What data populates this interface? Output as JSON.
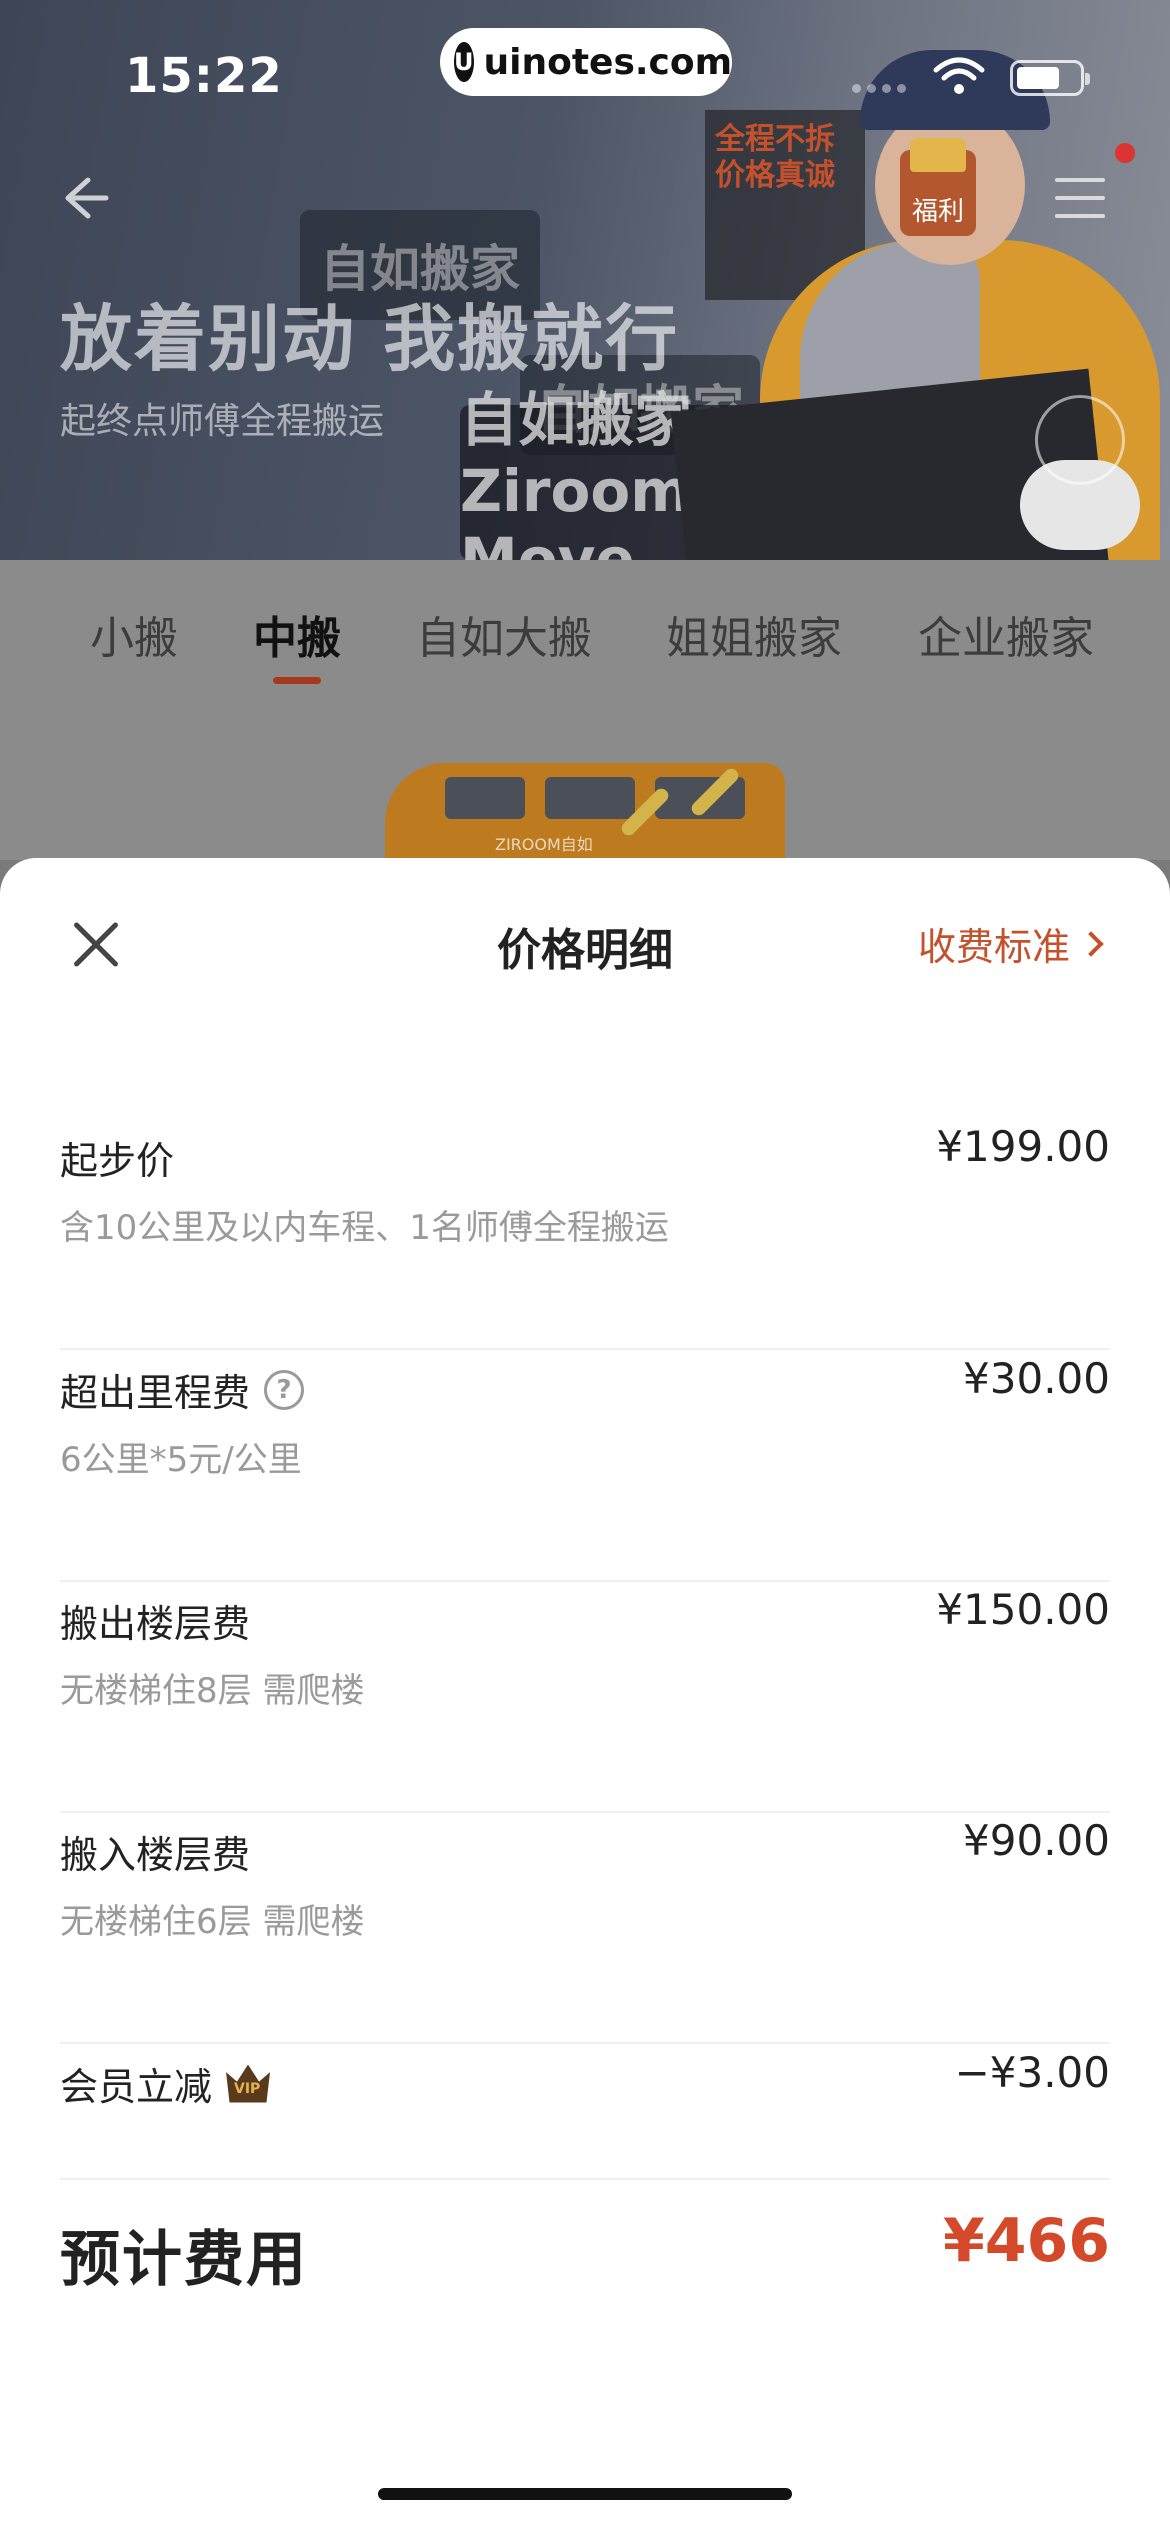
{
  "status_bar": {
    "time": "15:22",
    "watermark_logo": "U",
    "watermark": "uinotes.com"
  },
  "hero": {
    "title": "放着别动 我搬就行",
    "subtitle": "起终点师傅全程搬运",
    "board_texts": [
      "自如搬家",
      "自如搬家",
      "自如搬家 Ziroom Move"
    ],
    "sign_text": "全程不拆 价格真诚",
    "welfare_badge": "福利"
  },
  "tabs": [
    {
      "label": "小搬",
      "active": false
    },
    {
      "label": "中搬",
      "active": true
    },
    {
      "label": "自如大搬",
      "active": false
    },
    {
      "label": "姐姐搬家",
      "active": false
    },
    {
      "label": "企业搬家",
      "active": false
    }
  ],
  "vehicle": {
    "logo_text": "ZIROOM自如"
  },
  "sheet": {
    "title": "价格明细",
    "fee_standard_link": "收费标准",
    "items": [
      {
        "label": "起步价",
        "desc": "含10公里及以内车程、1名师傅全程搬运",
        "amount": "¥199.00"
      },
      {
        "label": "超出里程费",
        "desc": "6公里*5元/公里",
        "amount": "¥30.00",
        "icon": "help-icon"
      },
      {
        "label": "搬出楼层费",
        "desc": "无楼梯住8层 需爬楼",
        "amount": "¥150.00"
      },
      {
        "label": "搬入楼层费",
        "desc": "无楼梯住6层 需爬楼",
        "amount": "¥90.00"
      },
      {
        "label": "会员立减",
        "desc": "",
        "amount": "−¥3.00",
        "icon": "vip-crown-icon",
        "icon_text": "VIP"
      }
    ],
    "total_label": "预计费用",
    "total_amount": "¥466"
  },
  "colors": {
    "accent": "#c4512c",
    "total": "#d4492a",
    "tab_underline": "#a6381d"
  }
}
